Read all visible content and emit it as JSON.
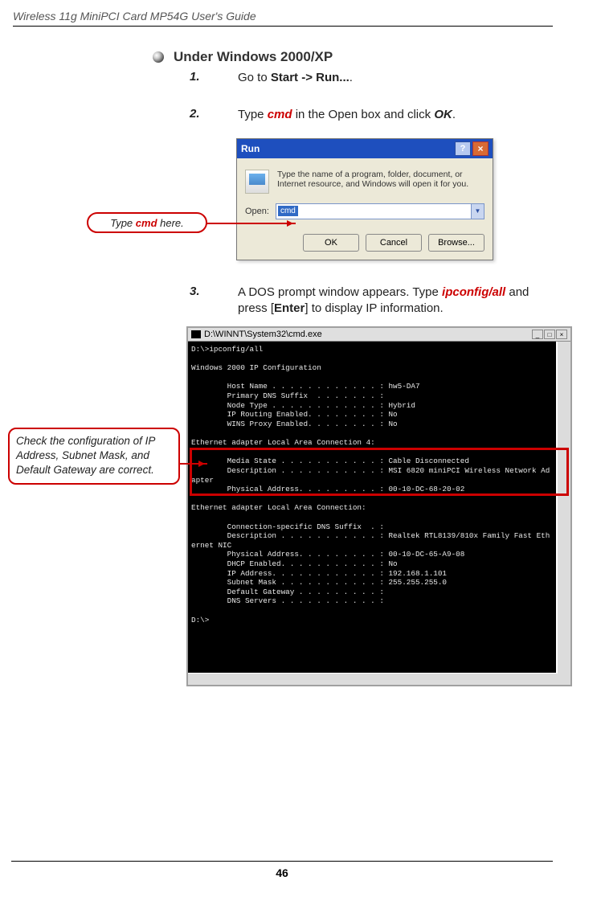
{
  "doc": {
    "title": "Wireless 11g MiniPCI Card MP54G User's Guide",
    "page_number": "46"
  },
  "section": {
    "heading": "Under Windows 2000/XP"
  },
  "steps": {
    "s1": {
      "num": "1.",
      "t1": "Go to ",
      "t2": "Start -> Run...",
      "t3": "."
    },
    "s2": {
      "num": "2.",
      "t1": "Type ",
      "cmd": "cmd",
      "t2": " in the Open box and click ",
      "ok": "OK",
      "t3": "."
    },
    "s3": {
      "num": "3.",
      "t1": "A DOS prompt window appears.  Type ",
      "cmd": "ipconfig/all",
      "t2": " and press [",
      "enter": "Enter",
      "t3": "] to display IP information."
    }
  },
  "callouts": {
    "c1": {
      "t1": "Type ",
      "cmd": "cmd",
      "t2": " here."
    },
    "c2": "Check the configuration of IP Address, Subnet Mask, and Default Gateway are correct."
  },
  "run_dialog": {
    "title": "Run",
    "description": "Type the name of a program, folder, document, or Internet resource, and Windows will open it for you.",
    "open_label": "Open:",
    "open_value": "cmd",
    "btn_ok": "OK",
    "btn_cancel": "Cancel",
    "btn_browse": "Browse..."
  },
  "dos": {
    "title": "D:\\WINNT\\System32\\cmd.exe",
    "body": "D:\\>ipconfig/all\n\nWindows 2000 IP Configuration\n\n        Host Name . . . . . . . . . . . . : hw5-DA7\n        Primary DNS Suffix  . . . . . . . :\n        Node Type . . . . . . . . . . . . : Hybrid\n        IP Routing Enabled. . . . . . . . : No\n        WINS Proxy Enabled. . . . . . . . : No\n\nEthernet adapter Local Area Connection 4:\n\n        Media State . . . . . . . . . . . : Cable Disconnected\n        Description . . . . . . . . . . . : MSI 6820 miniPCI Wireless Network Ad\napter\n        Physical Address. . . . . . . . . : 00-10-DC-68-20-02\n\nEthernet adapter Local Area Connection:\n\n        Connection-specific DNS Suffix  . :\n        Description . . . . . . . . . . . : Realtek RTL8139/810x Family Fast Eth\nernet NIC\n        Physical Address. . . . . . . . . : 00-10-DC-65-A9-08\n        DHCP Enabled. . . . . . . . . . . : No\n        IP Address. . . . . . . . . . . . : 192.168.1.101\n        Subnet Mask . . . . . . . . . . . : 255.255.255.0\n        Default Gateway . . . . . . . . . :\n        DNS Servers . . . . . . . . . . . :\n\nD:\\>"
  }
}
